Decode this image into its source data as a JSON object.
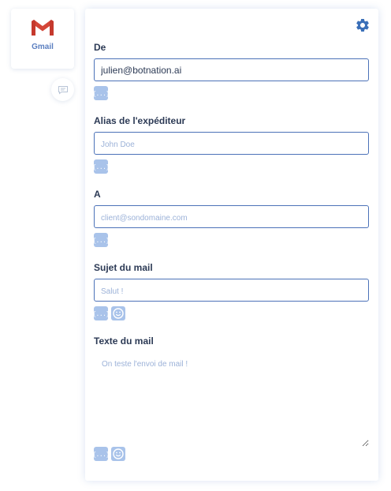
{
  "node": {
    "label": "Gmail",
    "logo_icon": "gmail-logo-icon",
    "comment_icon": "comment-icon"
  },
  "panel": {
    "settings_icon": "gear-icon",
    "fields": {
      "from": {
        "label": "De",
        "value": "julien@botnation.ai",
        "placeholder": ""
      },
      "alias": {
        "label": "Alias de l'expéditeur",
        "value": "",
        "placeholder": "John Doe"
      },
      "to": {
        "label": "A",
        "value": "",
        "placeholder": "client@sondomaine.com"
      },
      "subject": {
        "label": "Sujet du mail",
        "value": "",
        "placeholder": "Salut !"
      },
      "body": {
        "label": "Texte du mail",
        "value": "",
        "placeholder": "On teste l'envoi de mail !"
      }
    },
    "variable_button_glyph": "{...}"
  },
  "colors": {
    "accent": "#4c72b8",
    "gear": "#3a6fb8",
    "label": "#2c3a55",
    "placeholder": "#9cb2d8",
    "button_bg": "#a9c3ea",
    "gmail_red": "#d44638"
  }
}
